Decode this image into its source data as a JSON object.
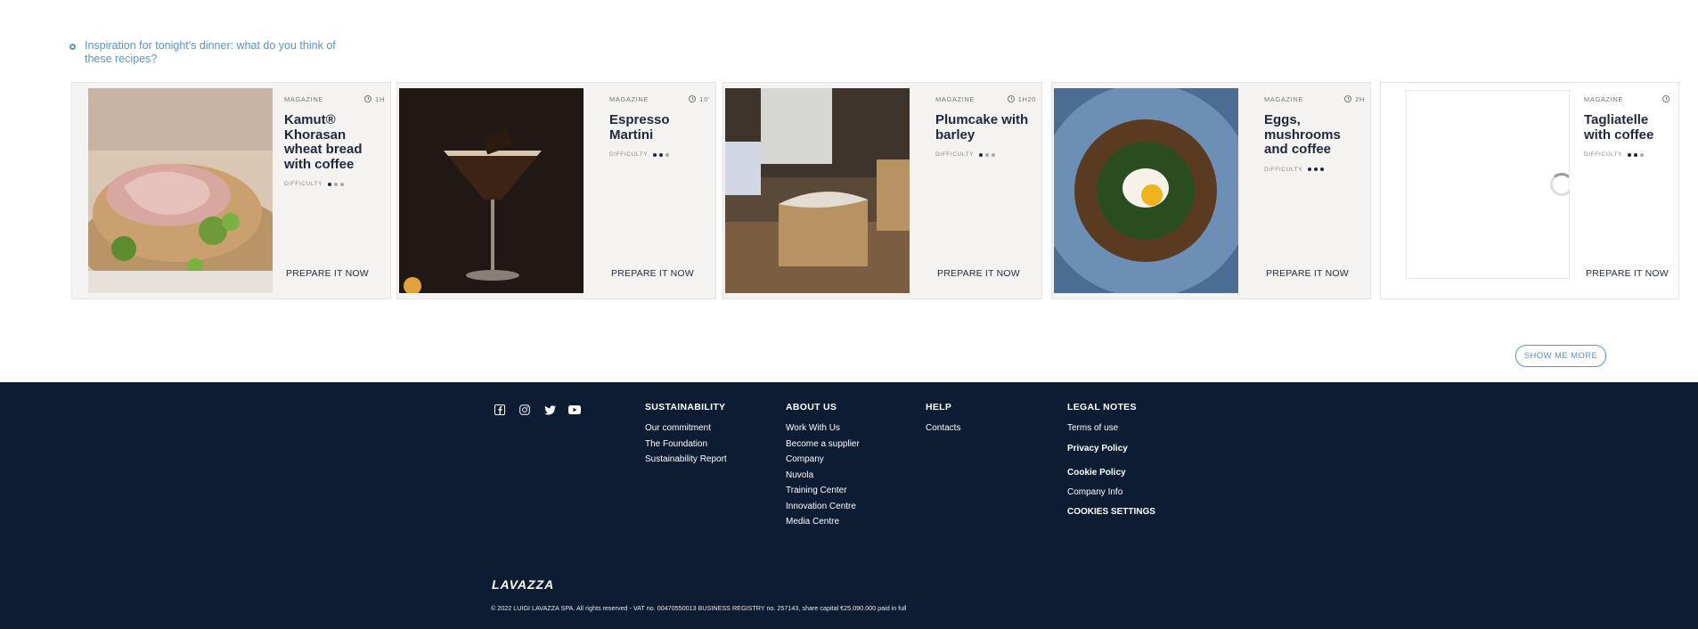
{
  "intro": {
    "text_before": "Inspiration for ",
    "link": "tonight's",
    "text_after": " dinner: what do you think of these recipes?"
  },
  "recipes": [
    {
      "magazine": "MAGAZINE",
      "time": "1H",
      "title": "Kamut® Khorasan wheat bread with coffee",
      "difficulty_label": "DIFFICULTY",
      "difficulty_level": 1,
      "cta": "PREPARE IT NOW"
    },
    {
      "magazine": "MAGAZINE",
      "time": "10'",
      "title": "Espresso Martini",
      "difficulty_label": "DIFFICULTY",
      "difficulty_level": 2,
      "cta": "PREPARE IT NOW"
    },
    {
      "magazine": "MAGAZINE",
      "time": "1H20",
      "title": "Plumcake with barley",
      "difficulty_label": "DIFFICULTY",
      "difficulty_level": 1,
      "cta": "PREPARE IT NOW"
    },
    {
      "magazine": "MAGAZINE",
      "time": "2H",
      "title": "Eggs, mushrooms and coffee",
      "difficulty_label": "DIFFICULTY",
      "difficulty_level": 3,
      "cta": "PREPARE IT NOW"
    },
    {
      "magazine": "MAGAZINE",
      "time": "",
      "title": "Tagliatelle with coffee",
      "difficulty_label": "DIFFICULTY",
      "difficulty_level": 2,
      "cta": "PREPARE IT NOW"
    }
  ],
  "show_more": "SHOW ME MORE",
  "footer": {
    "socials": [
      "facebook-icon",
      "instagram-icon",
      "twitter-icon",
      "youtube-icon"
    ],
    "sustainability": {
      "title": "SUSTAINABILITY",
      "links": [
        "Our commitment",
        "The Foundation",
        "Sustainability Report"
      ]
    },
    "about": {
      "title": "ABOUT US",
      "links": [
        "Work With Us",
        "Become a supplier",
        "Company",
        "Nuvola",
        "Training Center",
        "Innovation Centre",
        "Media Centre"
      ]
    },
    "help": {
      "title": "HELP",
      "links": [
        "Contacts"
      ]
    },
    "legal": {
      "title": "LEGAL NOTES",
      "links": [
        "Terms of use"
      ],
      "bold_links": [
        "Privacy Policy",
        "Cookie Policy"
      ],
      "links2": [
        "Company Info"
      ],
      "settings": "COOKIES SETTINGS"
    },
    "logo": "LAVAZZA",
    "copyright": "© 2022 LUIGI LAVAZZA SPA. All rights reserved - VAT no. 00470550013 BUSINESS REGISTRY no. 257143, share capital €25.090.000 paid in full"
  },
  "colors": {
    "accent": "#5b93c7",
    "footer_bg": "#0c1c32",
    "title": "#1f2740"
  }
}
